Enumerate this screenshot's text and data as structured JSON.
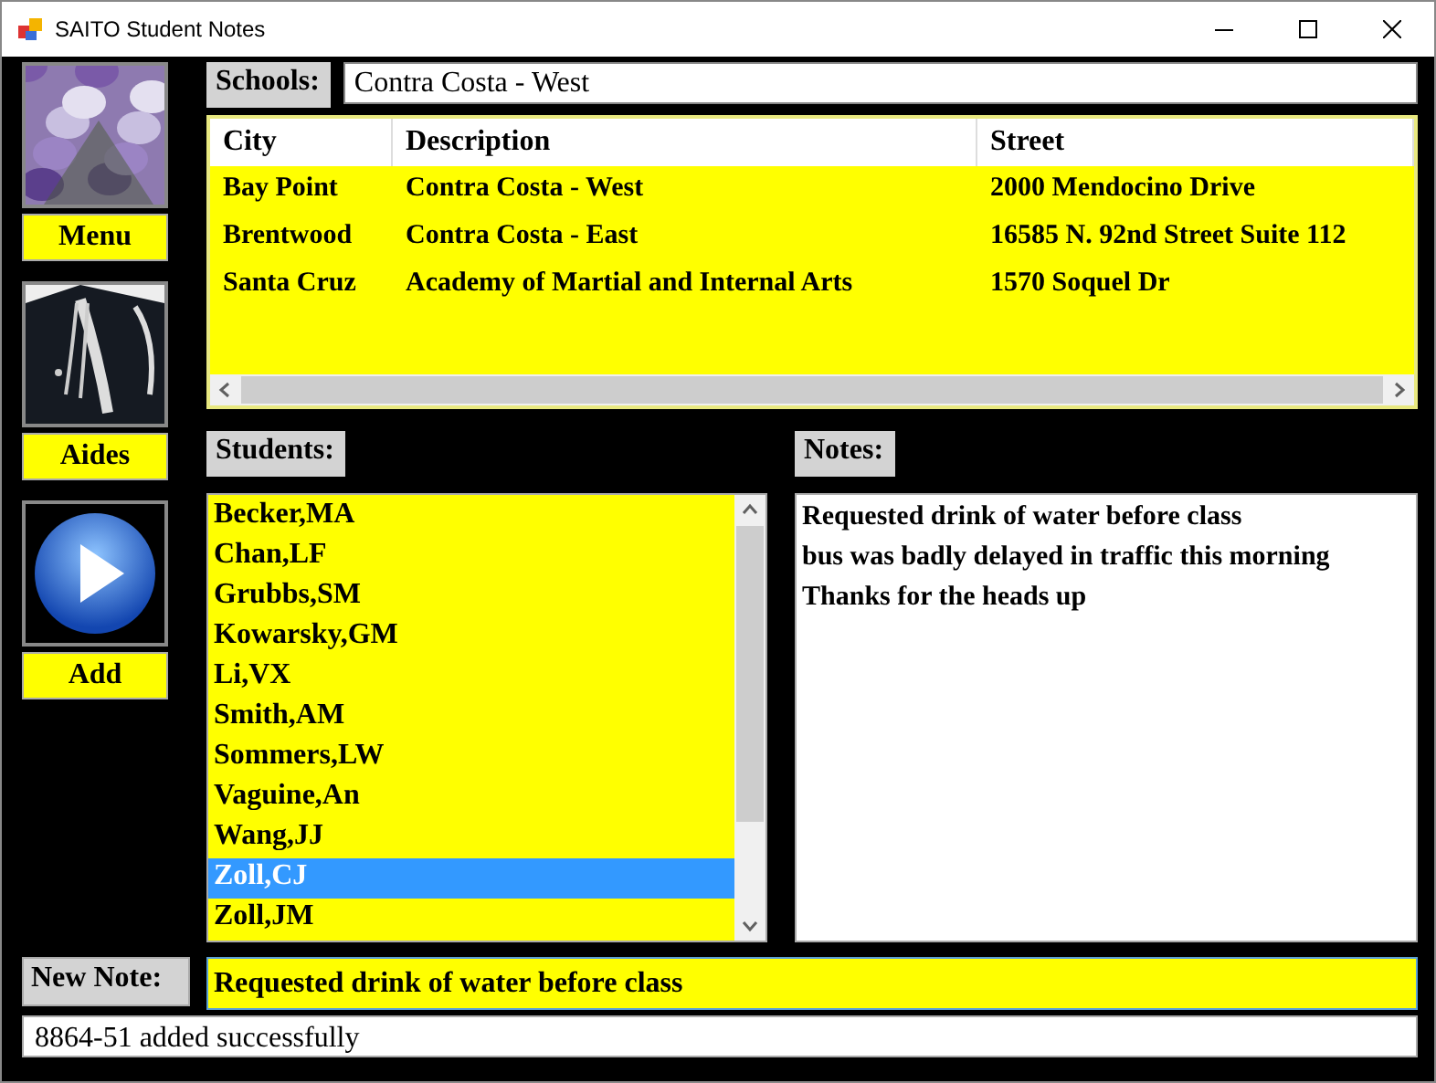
{
  "window": {
    "title": "SAITO Student Notes"
  },
  "sidebar": {
    "items": [
      {
        "label": "Menu"
      },
      {
        "label": "Aides"
      },
      {
        "label": "Add"
      }
    ]
  },
  "schools": {
    "label": "Schools:",
    "value": "Contra Costa - West"
  },
  "table": {
    "columns": [
      "City",
      "Description",
      "Street"
    ],
    "rows": [
      [
        "Bay Point",
        "Contra Costa - West",
        "2000 Mendocino Drive"
      ],
      [
        "Brentwood",
        "Contra Costa - East",
        "16585 N. 92nd Street Suite 112"
      ],
      [
        "Santa Cruz",
        "Academy of Martial and Internal Arts",
        "1570 Soquel Dr"
      ]
    ]
  },
  "students": {
    "label": "Students:",
    "items": [
      {
        "name": "Becker,MA",
        "selected": false
      },
      {
        "name": "Chan,LF",
        "selected": false
      },
      {
        "name": "Grubbs,SM",
        "selected": false
      },
      {
        "name": "Kowarsky,GM",
        "selected": false
      },
      {
        "name": "Li,VX",
        "selected": false
      },
      {
        "name": "Smith,AM",
        "selected": false
      },
      {
        "name": "Sommers,LW",
        "selected": false
      },
      {
        "name": "Vaguine,An",
        "selected": false
      },
      {
        "name": "Wang,JJ",
        "selected": false
      },
      {
        "name": "Zoll,CJ",
        "selected": true
      },
      {
        "name": "Zoll,JM",
        "selected": false
      }
    ]
  },
  "notes": {
    "label": "Notes:",
    "lines": [
      "Requested drink of water before class",
      "bus was badly delayed in traffic this morning",
      "Thanks for the heads up"
    ]
  },
  "new_note": {
    "label": "New Note:",
    "value": "Requested drink of water before class"
  },
  "status_bar": {
    "text": "8864-51 added successfully"
  }
}
